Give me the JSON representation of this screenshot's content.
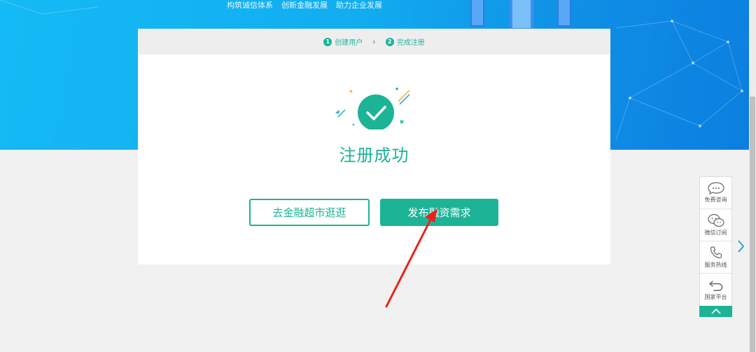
{
  "banner": {
    "slogans": [
      "构筑诚信体系",
      "创新金融发展",
      "助力企业发展"
    ]
  },
  "steps": [
    {
      "num": "1",
      "label": "创建用户"
    },
    {
      "num": "2",
      "label": "完成注册"
    }
  ],
  "steps_separator": "›",
  "success_title": "注册成功",
  "buttons": {
    "browse_market": "去金融超市逛逛",
    "publish_demand": "发布融资需求"
  },
  "side_panel": {
    "items": [
      {
        "label": "免费咨询",
        "icon": "chat-bubble-icon"
      },
      {
        "label": "微信订阅",
        "icon": "wechat-icon"
      },
      {
        "label": "服务热线",
        "icon": "phone-icon"
      },
      {
        "label": "国家平台",
        "icon": "return-arrow-icon"
      }
    ],
    "top_icon": "chevron-up-icon",
    "collapse_icon": "chevron-right-icon"
  },
  "colors": {
    "accent": "#1db396",
    "banner": "#12aef0",
    "annotation": "#e8231c"
  }
}
